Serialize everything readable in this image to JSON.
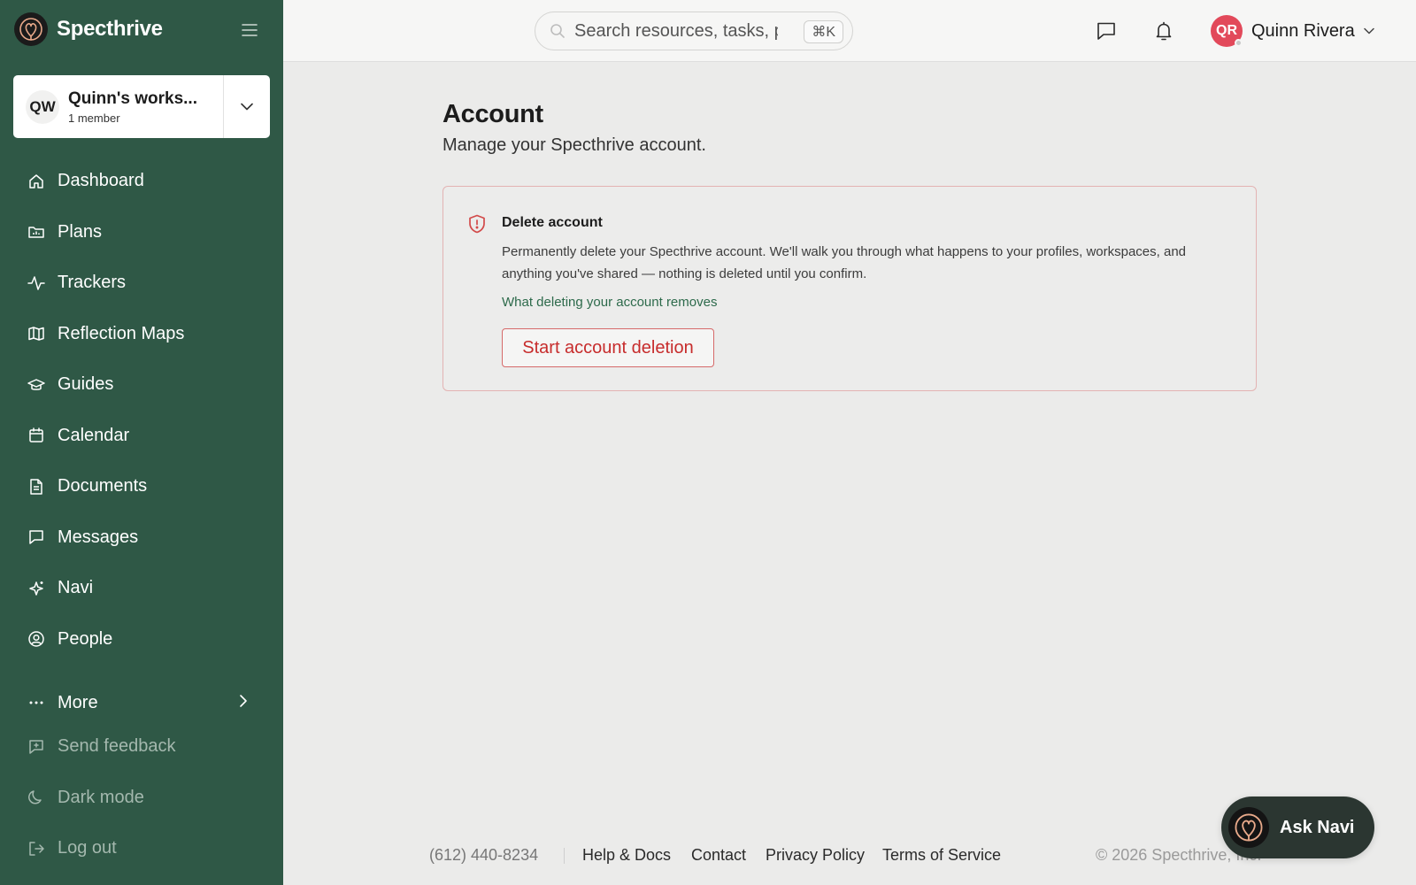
{
  "app": {
    "brand": "Specthrive"
  },
  "workspace": {
    "initials": "QW",
    "name": "Quinn's works...",
    "members": "1 member"
  },
  "nav": {
    "items": [
      {
        "label": "Dashboard",
        "icon": "home-icon"
      },
      {
        "label": "Plans",
        "icon": "folder-chart-icon"
      },
      {
        "label": "Trackers",
        "icon": "activity-icon"
      },
      {
        "label": "Reflection Maps",
        "icon": "map-icon"
      },
      {
        "label": "Guides",
        "icon": "graduation-cap-icon"
      },
      {
        "label": "Calendar",
        "icon": "calendar-icon"
      },
      {
        "label": "Documents",
        "icon": "document-icon"
      },
      {
        "label": "Messages",
        "icon": "message-icon"
      },
      {
        "label": "Navi",
        "icon": "sparkle-icon"
      },
      {
        "label": "People",
        "icon": "person-circle-icon"
      }
    ],
    "more": "More",
    "bottom": [
      {
        "label": "Send feedback",
        "icon": "feedback-icon"
      },
      {
        "label": "Dark mode",
        "icon": "moon-icon"
      },
      {
        "label": "Log out",
        "icon": "logout-icon"
      }
    ]
  },
  "topbar": {
    "search_placeholder": "Search resources, tasks, p",
    "shortcut": "⌘K",
    "user_initials": "QR",
    "user_name": "Quinn Rivera"
  },
  "main": {
    "title": "Account",
    "subtitle": "Manage your Specthrive account.",
    "danger": {
      "title": "Delete account",
      "description": "Permanently delete your Specthrive account. We'll walk you through what happens to your profiles, workspaces, and anything you've shared — nothing is deleted until you confirm.",
      "link": "What deleting your account removes",
      "button": "Start account deletion"
    }
  },
  "footer": {
    "phone": "(612) 440-8234",
    "links": [
      "Help & Docs",
      "Contact",
      "Privacy Policy",
      "Terms of Service"
    ],
    "copyright": "© 2026 Specthrive, Inc."
  },
  "ask_navi": {
    "label": "Ask Navi"
  },
  "colors": {
    "sidebar": "#2f5846",
    "accent_green": "#2d6a4b",
    "danger": "#c72c2c",
    "avatar": "#e2495a"
  }
}
